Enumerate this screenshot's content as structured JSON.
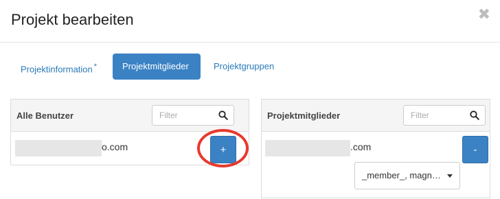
{
  "modal": {
    "title": "Projekt bearbeiten",
    "close_glyph": "✖"
  },
  "tabs": [
    {
      "label": "Projektinformation",
      "marker": "*",
      "active": false
    },
    {
      "label": "Projektmitglieder",
      "marker": "",
      "active": true
    },
    {
      "label": "Projektgruppen",
      "marker": "",
      "active": false
    }
  ],
  "all_users": {
    "title": "Alle Benutzer",
    "filter_placeholder": "Filter",
    "rows": [
      {
        "email_visible": "o.com",
        "add_label": "+"
      }
    ]
  },
  "members": {
    "title": "Projektmitglieder",
    "filter_placeholder": "Filter",
    "rows": [
      {
        "email_visible": ".com",
        "remove_label": "-",
        "roles_value": "_member_, magn…"
      }
    ]
  },
  "colors": {
    "accent": "#3b82c4",
    "highlight": "#e8392d"
  },
  "icons": [
    "close-icon",
    "search-icon",
    "caret-down-icon"
  ]
}
